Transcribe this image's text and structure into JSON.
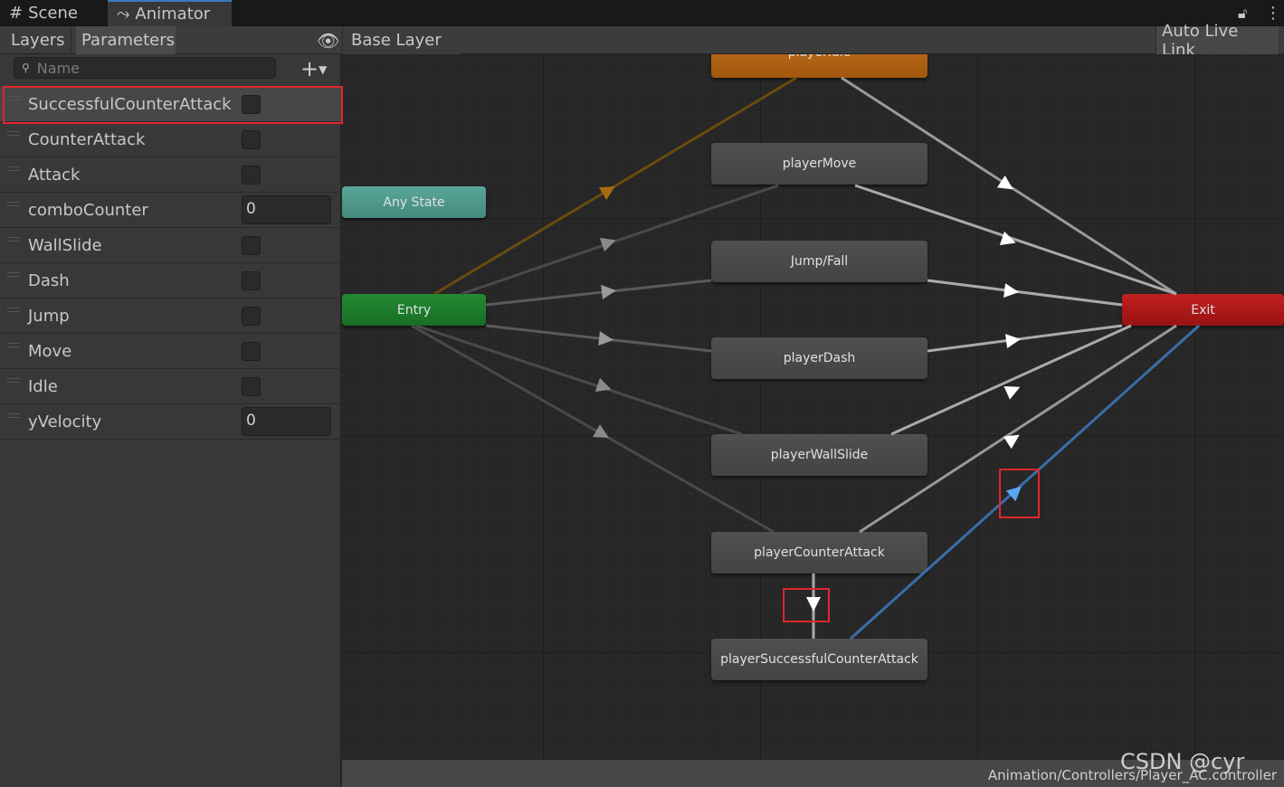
{
  "window_tabs": [
    {
      "label": "Scene",
      "icon": "grid-icon"
    },
    {
      "label": "Animator",
      "icon": "animator-icon",
      "active": true
    }
  ],
  "toolbar": {
    "layers": "Layers",
    "parameters": "Parameters",
    "breadcrumb": "Base Layer",
    "auto_live_link": "Auto Live Link"
  },
  "search": {
    "placeholder": "Name"
  },
  "parameters": [
    {
      "name": "SuccessfulCounterAttack",
      "type": "trigger",
      "highlighted": true
    },
    {
      "name": "CounterAttack",
      "type": "bool"
    },
    {
      "name": "Attack",
      "type": "bool"
    },
    {
      "name": "comboCounter",
      "type": "int",
      "value": "0"
    },
    {
      "name": "WallSlide",
      "type": "bool"
    },
    {
      "name": "Dash",
      "type": "bool"
    },
    {
      "name": "Jump",
      "type": "bool"
    },
    {
      "name": "Move",
      "type": "bool"
    },
    {
      "name": "Idle",
      "type": "bool"
    },
    {
      "name": "yVelocity",
      "type": "float",
      "value": "0"
    }
  ],
  "states": {
    "idle": "playerIdle",
    "move": "playerMove",
    "jump": "Jump/Fall",
    "dash": "playerDash",
    "wallslide": "playerWallSlide",
    "counter": "playerCounterAttack",
    "success": "playerSuccessfulCounterAttack",
    "any": "Any State",
    "entry": "Entry",
    "exit": "Exit"
  },
  "colors": {
    "default_state": "#b8681a",
    "entry": "#1e7a2c",
    "any_state": "#4f9a8e",
    "exit": "#b01b1b",
    "selected_transition": "#3a6ea8",
    "highlight": "#e0262b"
  },
  "footer": {
    "path": "Animation/Controllers/Player_AC.controller",
    "watermark": "CSDN @cyr"
  }
}
